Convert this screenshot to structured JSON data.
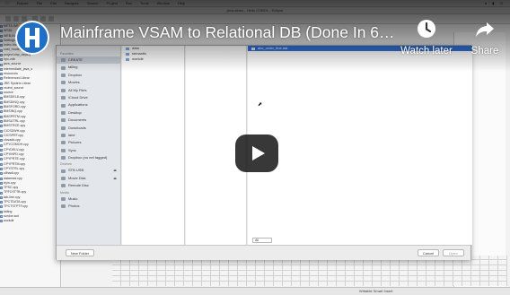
{
  "video": {
    "title": "Mainframe VSAM to Relational DB (Done In 6…",
    "watch_later_label": "Watch later",
    "share_label": "Share"
  },
  "menubar": {
    "items": [
      "Eclipse",
      "File",
      "Edit",
      "Navigate",
      "Search",
      "Project",
      "Run",
      "Tools",
      "Window",
      "Help"
    ]
  },
  "window": {
    "title": "java-demo - Hello COBOL - Eclipse"
  },
  "explorer": {
    "items": [
      "META-INF",
      "WSDL",
      "WEB-INF",
      "Settings.xml",
      "Index.html",
      "cust_modify",
      "project.xbp_deploy",
      "hpc-vdb",
      "java_source",
      "intermediate_java_s",
      "resources",
      "Referenced Librar",
      "JRE System Librar",
      "xxdmt_source",
      "source",
      "BMSDEL8.cpy",
      "BMSDINQ.cpy",
      "BMSFORD.cpy",
      "BMSINQ.cpy",
      "BMSPRTM.cpy",
      "BMSUTRL.cpy",
      "BMSTRCE.cpy",
      "CICSDWH.cpy",
      "CICSPRT.cpy",
      "cicsadd.cpy",
      "CPYCOMOH.cpy",
      "CPYDELV.cpy",
      "CPYINPD.cpy",
      "CPYPRTE.cpy",
      "CPYPRTM.cpy",
      "CPYSTRL.cpy",
      "ctlhadl.cpy",
      "dataread.cpy",
      "tryin.cpy",
      "TPSC.cpy",
      "TPFCSTTB.cpy",
      "tab-line.cpy",
      "TPCTDATA.cpy",
      "TPCTSTPTF.cpy",
      "tailing",
      "sunloe.scrl",
      "workdir"
    ]
  },
  "dialog": {
    "favorites_title": "Favorites",
    "favorites": [
      "CREATE",
      "tailing",
      "Dropbox",
      "Movies",
      "All My Files",
      "iCloud Drive",
      "Applications",
      "Desktop",
      "Documents",
      "Downloads",
      "iane",
      "Pictures",
      "Sync",
      "Dropbox (no net tagged)"
    ],
    "devices_title": "Devices",
    "devices": [
      "STB USB",
      "Movie Disk",
      "Remote Disc"
    ],
    "media_title": "Media",
    "media": [
      "Music",
      "Photos"
    ],
    "col1_items": [
      "data",
      "semantic",
      "workdir"
    ],
    "col3_items": [
      "abc_order_fine.dat"
    ],
    "format_label": "All",
    "new_folder_label": "New Folder",
    "cancel_label": "Cancel",
    "open_label": "Open"
  },
  "statusbar": {
    "text": "Writable    Smart Insert"
  },
  "colors": {
    "selection": "#2f6fd5",
    "youtube_overlay": "#000000",
    "logo_blue": "#1f6fc6"
  }
}
